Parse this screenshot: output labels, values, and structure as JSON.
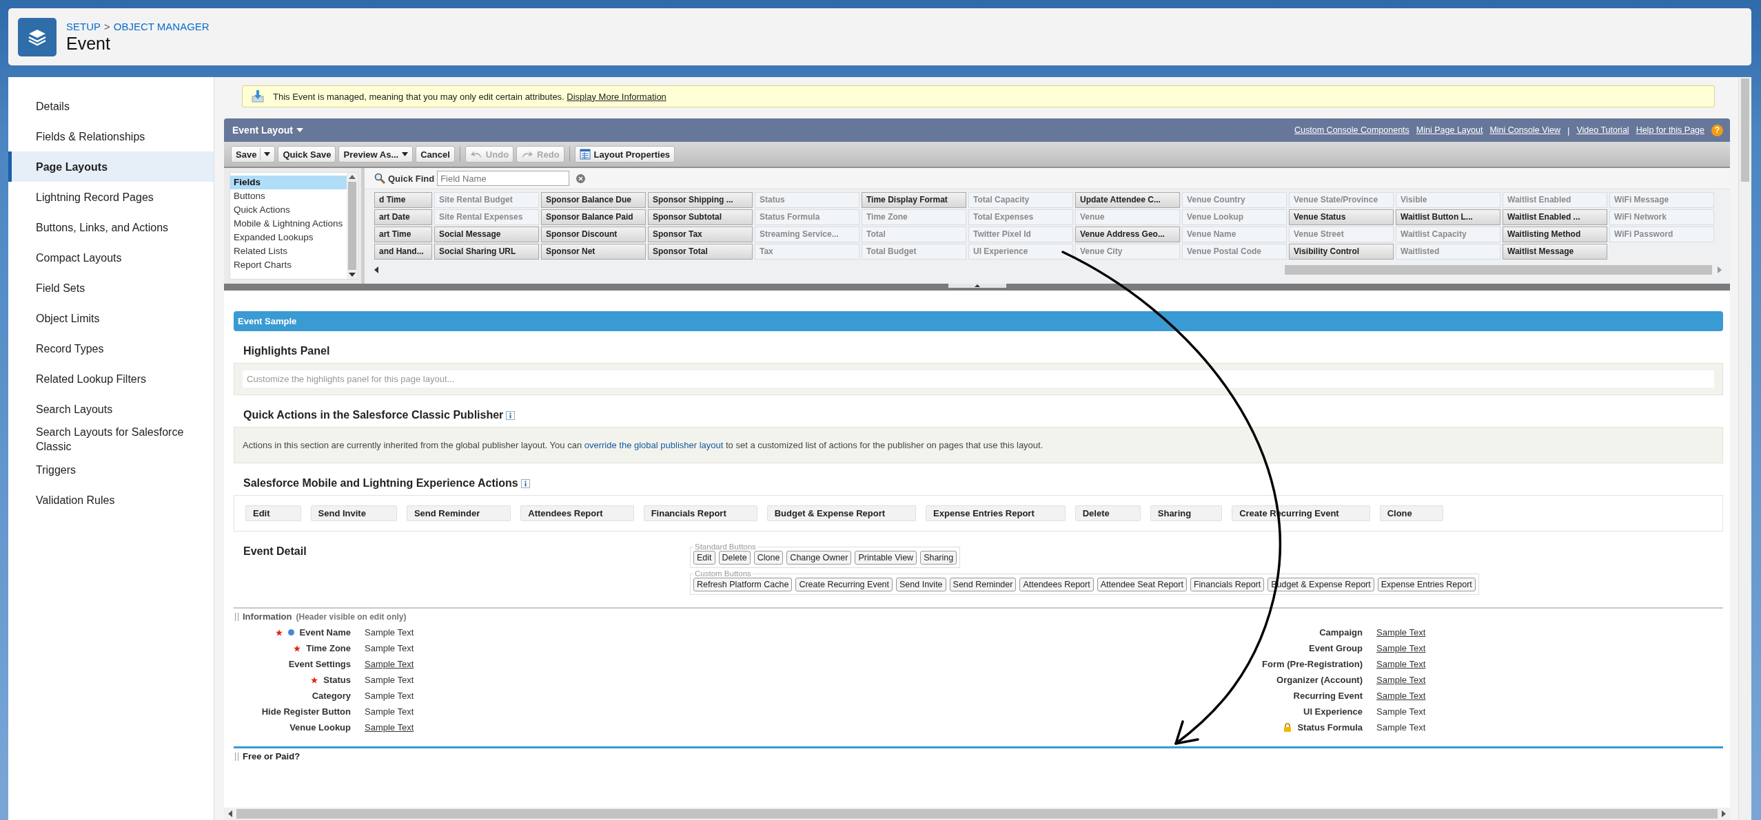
{
  "header": {
    "breadcrumb": [
      "SETUP",
      "OBJECT MANAGER"
    ],
    "separator": ">",
    "title": "Event"
  },
  "sidebar": {
    "items": [
      {
        "label": "Details",
        "selected": false
      },
      {
        "label": "Fields & Relationships",
        "selected": false
      },
      {
        "label": "Page Layouts",
        "selected": true
      },
      {
        "label": "Lightning Record Pages",
        "selected": false
      },
      {
        "label": "Buttons, Links, and Actions",
        "selected": false
      },
      {
        "label": "Compact Layouts",
        "selected": false
      },
      {
        "label": "Field Sets",
        "selected": false
      },
      {
        "label": "Object Limits",
        "selected": false
      },
      {
        "label": "Record Types",
        "selected": false
      },
      {
        "label": "Related Lookup Filters",
        "selected": false
      },
      {
        "label": "Search Layouts",
        "selected": false
      },
      {
        "label": "Search Layouts for Salesforce Classic",
        "selected": false
      },
      {
        "label": "Triggers",
        "selected": false
      },
      {
        "label": "Validation Rules",
        "selected": false
      }
    ]
  },
  "notice": {
    "text": "This Event is managed, meaning that you may only edit certain attributes.",
    "link": "Display More Information"
  },
  "layout_editor": {
    "title": "Event Layout",
    "links": [
      "Custom Console Components",
      "Mini Page Layout",
      "Mini Console View"
    ],
    "separator": "|",
    "help_links": [
      "Video Tutorial",
      "Help for this Page"
    ],
    "help": "?",
    "toolbar": [
      {
        "label": "Save",
        "kind": "split",
        "disabled": false
      },
      {
        "label": "Quick Save",
        "kind": "plain",
        "disabled": false
      },
      {
        "label": "Preview As...",
        "kind": "dropdown",
        "disabled": false
      },
      {
        "label": "Cancel",
        "kind": "plain",
        "disabled": false
      },
      {
        "label": "Undo",
        "kind": "undo",
        "disabled": true
      },
      {
        "label": "Redo",
        "kind": "redo",
        "disabled": true
      },
      {
        "label": "Layout Properties",
        "kind": "properties",
        "disabled": false
      }
    ],
    "categories": [
      {
        "label": "Fields",
        "selected": true
      },
      {
        "label": "Buttons",
        "selected": false
      },
      {
        "label": "Quick Actions",
        "selected": false
      },
      {
        "label": "Mobile & Lightning Actions",
        "selected": false
      },
      {
        "label": "Expanded Lookups",
        "selected": false
      },
      {
        "label": "Related Lists",
        "selected": false
      },
      {
        "label": "Report Charts",
        "selected": false
      }
    ],
    "quick_find": {
      "label": "Quick Find",
      "placeholder": "Field Name"
    },
    "field_columns": [
      [
        {
          "label": "d Time",
          "placed": false
        },
        {
          "label": "art Date",
          "placed": false
        },
        {
          "label": "art Time",
          "placed": false
        },
        {
          "label": "and Hand...",
          "placed": false
        }
      ],
      [
        {
          "label": "Site Rental Budget",
          "placed": true
        },
        {
          "label": "Site Rental Expenses",
          "placed": true
        },
        {
          "label": "Social Message",
          "placed": false
        },
        {
          "label": "Social Sharing URL",
          "placed": false
        }
      ],
      [
        {
          "label": "Sponsor Balance Due",
          "placed": false
        },
        {
          "label": "Sponsor Balance Paid",
          "placed": false
        },
        {
          "label": "Sponsor Discount",
          "placed": false
        },
        {
          "label": "Sponsor Net",
          "placed": false
        }
      ],
      [
        {
          "label": "Sponsor Shipping ...",
          "placed": false
        },
        {
          "label": "Sponsor Subtotal",
          "placed": false
        },
        {
          "label": "Sponsor Tax",
          "placed": false
        },
        {
          "label": "Sponsor Total",
          "placed": false
        }
      ],
      [
        {
          "label": "Status",
          "placed": true
        },
        {
          "label": "Status Formula",
          "placed": true
        },
        {
          "label": "Streaming Service...",
          "placed": true
        },
        {
          "label": "Tax",
          "placed": true
        }
      ],
      [
        {
          "label": "Time Display Format",
          "placed": false
        },
        {
          "label": "Time Zone",
          "placed": true
        },
        {
          "label": "Total",
          "placed": true
        },
        {
          "label": "Total Budget",
          "placed": true
        }
      ],
      [
        {
          "label": "Total Capacity",
          "placed": true
        },
        {
          "label": "Total Expenses",
          "placed": true
        },
        {
          "label": "Twitter Pixel Id",
          "placed": true
        },
        {
          "label": "UI Experience",
          "placed": true
        }
      ],
      [
        {
          "label": "Update Attendee C...",
          "placed": false
        },
        {
          "label": "Venue",
          "placed": true
        },
        {
          "label": "Venue Address Geo...",
          "placed": false
        },
        {
          "label": "Venue City",
          "placed": true
        }
      ],
      [
        {
          "label": "Venue Country",
          "placed": true
        },
        {
          "label": "Venue Lookup",
          "placed": true
        },
        {
          "label": "Venue Name",
          "placed": true
        },
        {
          "label": "Venue Postal Code",
          "placed": true
        }
      ],
      [
        {
          "label": "Venue State/Province",
          "placed": true
        },
        {
          "label": "Venue Status",
          "placed": false
        },
        {
          "label": "Venue Street",
          "placed": true
        },
        {
          "label": "Visibility Control",
          "placed": false
        }
      ],
      [
        {
          "label": "Visible",
          "placed": true
        },
        {
          "label": "Waitlist Button L...",
          "placed": false
        },
        {
          "label": "Waitlist Capacity",
          "placed": true
        },
        {
          "label": "Waitlisted",
          "placed": true
        }
      ],
      [
        {
          "label": "Waitlist Enabled",
          "placed": true
        },
        {
          "label": "Waitlist Enabled ...",
          "placed": false
        },
        {
          "label": "Waitlisting Method",
          "placed": false
        },
        {
          "label": "Waitlist Message",
          "placed": false
        }
      ],
      [
        {
          "label": "WiFi Message",
          "placed": true
        },
        {
          "label": "WiFi Network",
          "placed": true
        },
        {
          "label": "WiFi Password",
          "placed": true
        }
      ]
    ]
  },
  "sample": {
    "title": "Event Sample",
    "highlights": {
      "title": "Highlights Panel",
      "hint": "Customize the highlights panel for this page layout..."
    },
    "quick_actions": {
      "title": "Quick Actions in the Salesforce Classic Publisher",
      "text_before": "Actions in this section are currently inherited from the global publisher layout. You can",
      "link": "override the global publisher layout",
      "text_after": "to set a customized list of actions for the publisher on pages that use this layout."
    },
    "mobile_actions": {
      "title": "Salesforce Mobile and Lightning Experience Actions",
      "actions": [
        "Edit",
        "Send Invite",
        "Send Reminder",
        "Attendees Report",
        "Financials Report",
        "Budget & Expense Report",
        "Expense Entries Report",
        "Delete",
        "Sharing",
        "Create Recurring Event",
        "Clone"
      ]
    },
    "detail": {
      "title": "Event Detail",
      "standard": {
        "legend": "Standard Buttons",
        "buttons": [
          "Edit",
          "Delete",
          "Clone",
          "Change Owner",
          "Printable View",
          "Sharing"
        ]
      },
      "custom": {
        "legend": "Custom Buttons",
        "buttons": [
          "Refresh Platform Cache",
          "Create Recurring Event",
          "Send Invite",
          "Send Reminder",
          "Attendees Report",
          "Attendee Seat Report",
          "Financials Report",
          "Budget & Expense Report",
          "Expense Entries Report"
        ]
      }
    },
    "information": {
      "title": "Information",
      "note": "(Header visible on edit only)",
      "left": [
        {
          "label": "Event Name",
          "value": "Sample Text",
          "required": true,
          "indicator": true,
          "lookup": false
        },
        {
          "label": "Time Zone",
          "value": "Sample Text",
          "required": true,
          "lookup": false
        },
        {
          "label": "Event Settings",
          "value": "Sample Text",
          "lookup": true
        },
        {
          "label": "Status",
          "value": "Sample Text",
          "required": true,
          "lookup": false
        },
        {
          "label": "Category",
          "value": "Sample Text",
          "lookup": false
        },
        {
          "label": "Hide Register Button",
          "value": "Sample Text",
          "lookup": false
        },
        {
          "label": "Venue Lookup",
          "value": "Sample Text",
          "lookup": true
        }
      ],
      "right": [
        {
          "label": "Campaign",
          "value": "Sample Text",
          "lookup": true
        },
        {
          "label": "Event Group",
          "value": "Sample Text",
          "lookup": true
        },
        {
          "label": "Form (Pre-Registration)",
          "value": "Sample Text",
          "lookup": true
        },
        {
          "label": "Organizer (Account)",
          "value": "Sample Text",
          "lookup": true
        },
        {
          "label": "Recurring Event",
          "value": "Sample Text",
          "lookup": true
        },
        {
          "label": "UI Experience",
          "value": "Sample Text",
          "lookup": false
        },
        {
          "label": "Status Formula",
          "value": "Sample Text",
          "lookup": false,
          "locked": true
        }
      ]
    },
    "next_section": "Free or Paid?"
  }
}
